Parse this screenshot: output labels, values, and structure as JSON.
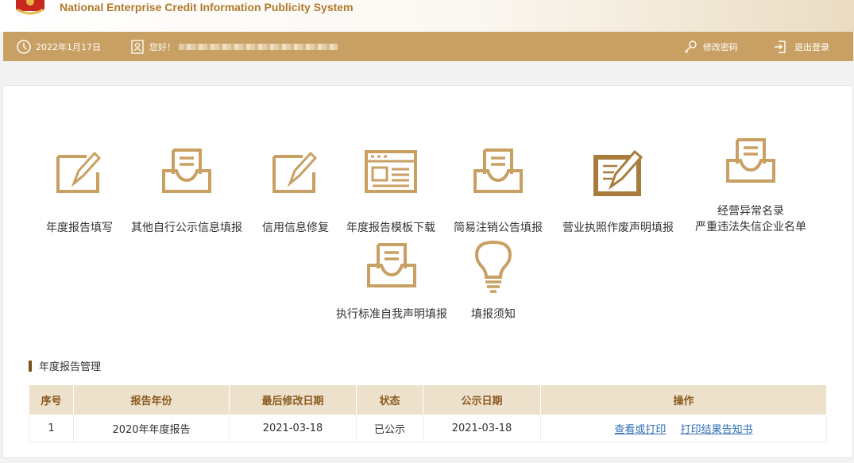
{
  "header": {
    "title": "National Enterprise Credit Information Publicity System"
  },
  "topbar": {
    "date": "2022年1月17日",
    "greeting": "您好！",
    "change_password": "修改密码",
    "logout": "退出登录"
  },
  "tiles": [
    {
      "label": "年度报告填写",
      "icon": "edit-icon"
    },
    {
      "label": "其他自行公示信息填报",
      "icon": "inbox-icon"
    },
    {
      "label": "信用信息修复",
      "icon": "edit-icon"
    },
    {
      "label": "年度报告模板下载",
      "icon": "template-icon"
    },
    {
      "label": "简易注销公告填报",
      "icon": "inbox-icon"
    },
    {
      "label": "营业执照作废声明填报",
      "icon": "edit-solid-icon"
    },
    {
      "label": "经营异常名录",
      "label2": "严重违法失信企业名单",
      "icon": "inbox-icon"
    },
    {
      "label": "执行标准自我声明填报",
      "icon": "inbox-icon"
    },
    {
      "label": "填报须知",
      "icon": "lightbulb-icon"
    }
  ],
  "section": {
    "title": "年度报告管理"
  },
  "table": {
    "headers": [
      "序号",
      "报告年份",
      "最后修改日期",
      "状态",
      "公示日期",
      "操作"
    ],
    "rows": [
      {
        "index": "1",
        "year": "2020年年度报告",
        "modified": "2021-03-18",
        "status": "已公示",
        "publish": "2021-03-18",
        "action1": "查看或打印",
        "action2": "打印结果告知书"
      }
    ]
  },
  "colors": {
    "accent": "#c9a063",
    "icon": "#c9a063",
    "link": "#2f6fb8"
  }
}
